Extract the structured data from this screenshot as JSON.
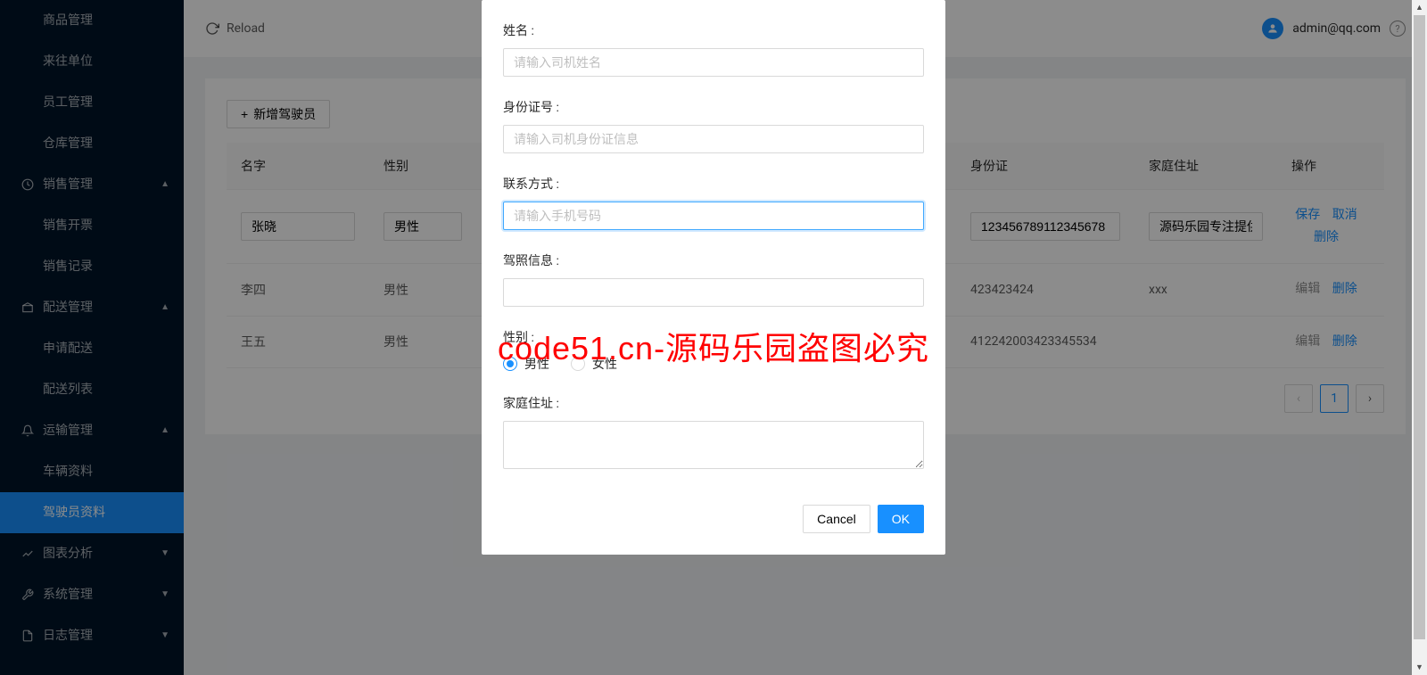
{
  "topbar": {
    "reload_label": "Reload",
    "user_email": "admin@qq.com"
  },
  "sidebar": {
    "items": [
      {
        "label": "商品管理",
        "type": "sub"
      },
      {
        "label": "来往单位",
        "type": "sub"
      },
      {
        "label": "员工管理",
        "type": "sub"
      },
      {
        "label": "仓库管理",
        "type": "sub"
      },
      {
        "label": "销售管理",
        "type": "top",
        "icon": "clock",
        "expanded": true
      },
      {
        "label": "销售开票",
        "type": "sub"
      },
      {
        "label": "销售记录",
        "type": "sub"
      },
      {
        "label": "配送管理",
        "type": "top",
        "icon": "package",
        "expanded": true
      },
      {
        "label": "申请配送",
        "type": "sub"
      },
      {
        "label": "配送列表",
        "type": "sub"
      },
      {
        "label": "运输管理",
        "type": "top",
        "icon": "bell",
        "expanded": true
      },
      {
        "label": "车辆资料",
        "type": "sub"
      },
      {
        "label": "驾驶员资料",
        "type": "sub",
        "selected": true
      },
      {
        "label": "图表分析",
        "type": "top",
        "icon": "chart",
        "expanded": false
      },
      {
        "label": "系统管理",
        "type": "top",
        "icon": "tool",
        "expanded": false
      },
      {
        "label": "日志管理",
        "type": "top",
        "icon": "file",
        "expanded": false
      }
    ]
  },
  "toolbar": {
    "add_driver_label": "新增驾驶员"
  },
  "table": {
    "headers": {
      "name": "名字",
      "gender": "性别",
      "idcard": "身份证",
      "address": "家庭住址",
      "action": "操作"
    },
    "rows": [
      {
        "editing": true,
        "name": "张晓",
        "gender": "男性",
        "idcard": "123456789112345678",
        "address": "源码乐园专注提供",
        "actions": {
          "save": "保存",
          "cancel": "取消",
          "delete": "删除"
        }
      },
      {
        "editing": false,
        "name": "李四",
        "gender": "男性",
        "idcard": "423423424",
        "address": "xxx",
        "actions": {
          "edit": "编辑",
          "delete": "删除"
        }
      },
      {
        "editing": false,
        "name": "王五",
        "gender": "男性",
        "idcard": "412242003423345534",
        "address": "",
        "actions": {
          "edit": "编辑",
          "delete": "删除"
        }
      }
    ]
  },
  "pagination": {
    "current": "1"
  },
  "modal": {
    "fields": {
      "name_label": "姓名 :",
      "name_placeholder": "请输入司机姓名",
      "idcard_label": "身份证号 :",
      "idcard_placeholder": "请输入司机身份证信息",
      "contact_label": "联系方式 :",
      "contact_placeholder": "请输入手机号码",
      "license_label": "驾照信息 :",
      "license_placeholder": "",
      "gender_label": "性别 :",
      "gender_male": "男性",
      "gender_female": "女性",
      "address_label": "家庭住址 :"
    },
    "footer": {
      "cancel": "Cancel",
      "ok": "OK"
    }
  },
  "watermark": "code51.cn-源码乐园盗图必究"
}
